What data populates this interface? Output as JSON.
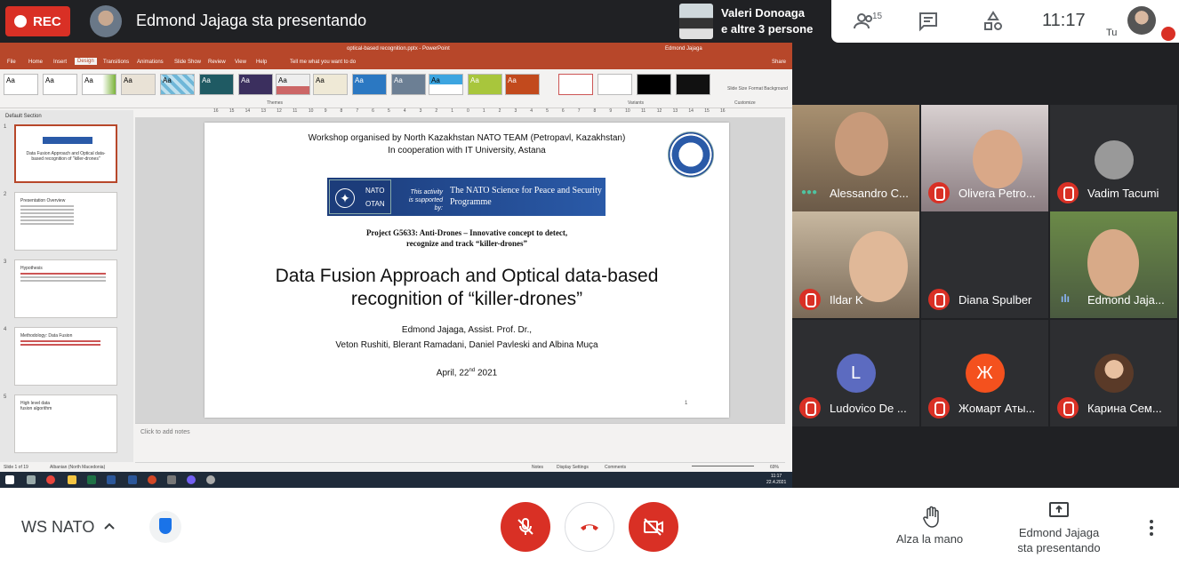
{
  "topbar": {
    "rec_label": "REC",
    "presenter_title": "Edmond Jajaga sta presentando",
    "speaker_line1": "Valeri Donoaga",
    "speaker_line2": "e altre 3 persone",
    "people_count": "15",
    "clock": "11:17",
    "self_label": "Tu"
  },
  "powerpoint": {
    "window_title": "optical-based recognition.pptx - PowerPoint",
    "user_name": "Edmond Jajaga",
    "tabs": [
      "File",
      "Home",
      "Insert",
      "Design",
      "Transitions",
      "Animations",
      "Slide Show",
      "Review",
      "View",
      "Help"
    ],
    "active_tab": "Design",
    "tell_me": "Tell me what you want to do",
    "share": "Share",
    "theme_sample": "Aa",
    "ribbon_themes_label": "Themes",
    "ribbon_variants_label": "Variants",
    "ribbon_customize_label": "Customize",
    "slide_size": "Slide Size",
    "format_background": "Format Background",
    "section_label": "Default Section",
    "thumbs": [
      {
        "num": "1",
        "title": "Data Fusion Approach and Optical data-based recognition of \"killer-drones\""
      },
      {
        "num": "2",
        "title": "Presentation Overview"
      },
      {
        "num": "3",
        "title": "Hypothesis"
      },
      {
        "num": "4",
        "title": "Methodology: Data Fusion"
      },
      {
        "num": "5",
        "title": "High level data fusion algorithm"
      }
    ],
    "notes_placeholder": "Click to add notes",
    "status_slide": "Slide 1 of 19",
    "status_lang": "Albanian (North Macedonia)",
    "status_notes": "Notes",
    "status_display": "Display Settings",
    "status_comments": "Comments",
    "zoom": "69%",
    "taskbar_time": "11:17",
    "taskbar_date": "22.4.2021",
    "ruler": [
      "16",
      "15",
      "14",
      "13",
      "12",
      "11",
      "10",
      "9",
      "8",
      "7",
      "6",
      "5",
      "4",
      "3",
      "2",
      "1",
      "0",
      "1",
      "2",
      "3",
      "4",
      "5",
      "6",
      "7",
      "8",
      "9",
      "10",
      "11",
      "12",
      "13",
      "14",
      "15",
      "16"
    ]
  },
  "slide": {
    "line1": "Workshop organised by North Kazakhstan NATO TEAM (Petropavl, Kazakhstan)",
    "line2": "In cooperation with IT University, Astana",
    "nato_top": "NATO",
    "nato_bottom": "OTAN",
    "nato_italic": "This activity is supported by:",
    "nato_program": "The NATO Science for Peace and Security Programme",
    "project_line1": "Project G5633: Anti-Drones – Innovative concept to detect,",
    "project_line2": "recognize and track “killer-drones”",
    "title_line1": "Data Fusion Approach and Optical data-based",
    "title_line2": "recognition of “killer-drones”",
    "authors1": "Edmond Jajaga, Assist. Prof. Dr.,",
    "authors2": "Veton Rushiti, Blerant Ramadani, Daniel Pavleski and Albina Muça",
    "date": "April, 22nd 2021",
    "page_number": "1"
  },
  "participants": [
    {
      "name": "Alessandro C...",
      "muted": false,
      "avatar": ""
    },
    {
      "name": "Olivera Petro...",
      "muted": true,
      "avatar": ""
    },
    {
      "name": "Vadim Tacumi",
      "muted": true,
      "avatar": ""
    },
    {
      "name": "Ildar K",
      "muted": true,
      "avatar": ""
    },
    {
      "name": "Diana Spulber",
      "muted": true,
      "avatar": ""
    },
    {
      "name": "Edmond Jaja...",
      "muted": false,
      "avatar": ""
    },
    {
      "name": "Ludovico De ...",
      "muted": true,
      "avatar": "L"
    },
    {
      "name": "Жомарт Аты...",
      "muted": true,
      "avatar": "Ж"
    },
    {
      "name": "Карина Сем...",
      "muted": true,
      "avatar": ""
    }
  ],
  "bottombar": {
    "meeting_name": "WS NATO",
    "raise_hand": "Alza la mano",
    "presenting_line1": "Edmond Jajaga",
    "presenting_line2": "sta presentando"
  },
  "colors": {
    "meet_red": "#d93025",
    "ppt_accent": "#b7472a",
    "meet_dark": "#202124",
    "avatar_l": "#5c6bc0",
    "avatar_zh": "#f4511e"
  }
}
